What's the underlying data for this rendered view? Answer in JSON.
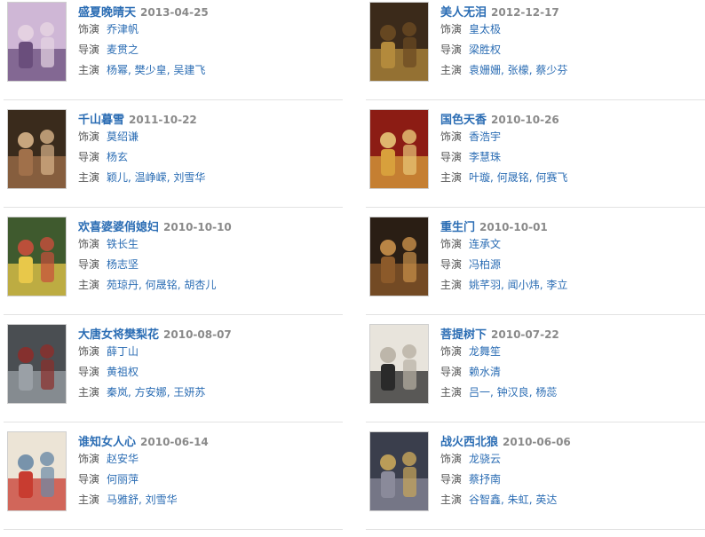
{
  "labels": {
    "dubbing": "饰演",
    "director": "导演",
    "cast": "主演"
  },
  "shows": [
    {
      "title": "盛夏晚晴天",
      "date": "2013-04-25",
      "dubbing": [
        "乔津帆"
      ],
      "director": [
        "麦贯之"
      ],
      "cast": [
        "杨幂",
        "樊少皇",
        "吴建飞"
      ],
      "colors": [
        "#cfb7d6",
        "#6a4e7c",
        "#e6d4e2"
      ]
    },
    {
      "title": "美人无泪",
      "date": "2012-12-17",
      "dubbing": [
        "皇太极"
      ],
      "director": [
        "梁胜权"
      ],
      "cast": [
        "袁姗姗",
        "张檬",
        "蔡少芬"
      ],
      "colors": [
        "#3b2a1a",
        "#b38a3c",
        "#6b4a22"
      ]
    },
    {
      "title": "千山暮雪",
      "date": "2011-10-22",
      "dubbing": [
        "莫绍谦"
      ],
      "director": [
        "杨玄"
      ],
      "cast": [
        "颖儿",
        "温峥嵘",
        "刘雪华"
      ],
      "colors": [
        "#3a2b1c",
        "#a0704a",
        "#d8b48a"
      ]
    },
    {
      "title": "国色天香",
      "date": "2010-10-26",
      "dubbing": [
        "香浩宇"
      ],
      "director": [
        "李慧珠"
      ],
      "cast": [
        "叶璇",
        "何晟铭",
        "何赛飞"
      ],
      "colors": [
        "#8c1c14",
        "#d8a03c",
        "#e8c878"
      ]
    },
    {
      "title": "欢喜婆婆俏媳妇",
      "date": "2010-10-10",
      "dubbing": [
        "铁长生"
      ],
      "director": [
        "杨志坚"
      ],
      "cast": [
        "苑琼丹",
        "何晟铭",
        "胡杏儿"
      ],
      "colors": [
        "#3f5a2e",
        "#e8c84a",
        "#c94e3c"
      ]
    },
    {
      "title": "重生门",
      "date": "2010-10-01",
      "dubbing": [
        "连承文"
      ],
      "director": [
        "冯柏源"
      ],
      "cast": [
        "姚芊羽",
        "闻小炜",
        "李立"
      ],
      "colors": [
        "#2a1e14",
        "#8c5a2a",
        "#c9904a"
      ]
    },
    {
      "title": "大唐女将樊梨花",
      "date": "2010-08-07",
      "dubbing": [
        "薛丁山"
      ],
      "director": [
        "黄祖权"
      ],
      "cast": [
        "秦岚",
        "方安娜",
        "王妍苏"
      ],
      "colors": [
        "#4a4e52",
        "#9aa0a6",
        "#8c2e2a"
      ]
    },
    {
      "title": "菩提树下",
      "date": "2010-07-22",
      "dubbing": [
        "龙舞笙"
      ],
      "director": [
        "赖水清"
      ],
      "cast": [
        "吕一",
        "钟汉良",
        "杨蕊"
      ],
      "colors": [
        "#e8e4dc",
        "#2a2a2a",
        "#b8b0a4"
      ]
    },
    {
      "title": "谁知女人心",
      "date": "2010-06-14",
      "dubbing": [
        "赵安华"
      ],
      "director": [
        "何丽萍"
      ],
      "cast": [
        "马雅舒",
        "刘雪华"
      ],
      "colors": [
        "#ece4d6",
        "#c83c30",
        "#6b8aa6"
      ]
    },
    {
      "title": "战火西北狼",
      "date": "2010-06-06",
      "dubbing": [
        "龙骁云"
      ],
      "director": [
        "蔡抒南"
      ],
      "cast": [
        "谷智鑫",
        "朱虹",
        "英达"
      ],
      "colors": [
        "#3a3e4c",
        "#8a8a9a",
        "#c9a65a"
      ]
    }
  ]
}
